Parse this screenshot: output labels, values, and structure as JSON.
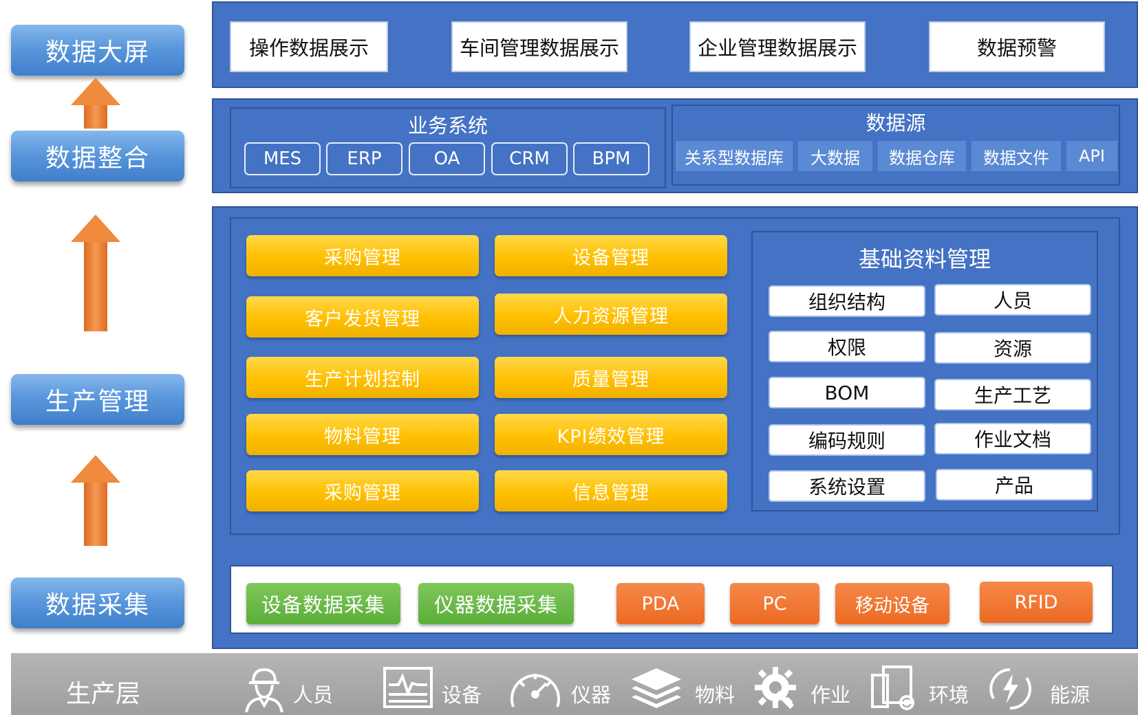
{
  "stages": {
    "display": "数据大屏",
    "integration": "数据整合",
    "production": "生产管理",
    "collection": "数据采集"
  },
  "top_row": [
    "操作数据展示",
    "车间管理数据展示",
    "企业管理数据展示",
    "数据预警"
  ],
  "business_system": {
    "title": "业务系统",
    "items": [
      "MES",
      "ERP",
      "OA",
      "CRM",
      "BPM"
    ]
  },
  "data_source": {
    "title": "数据源",
    "items": [
      "关系型数据库",
      "大数据",
      "数据仓库",
      "数据文件",
      "API"
    ]
  },
  "management_modules": {
    "left": [
      "采购管理",
      "客户发货管理",
      "生产计划控制",
      "物料管理",
      "采购管理"
    ],
    "right": [
      "设备管理",
      "人力资源管理",
      "质量管理",
      "KPI绩效管理",
      "信息管理"
    ]
  },
  "basic_data": {
    "title": "基础资料管理",
    "items": [
      "组织结构",
      "人员",
      "权限",
      "资源",
      "BOM",
      "生产工艺",
      "编码规则",
      "作业文档",
      "系统设置",
      "产品"
    ]
  },
  "collection_row": {
    "green": [
      "设备数据采集",
      "仪器数据采集"
    ],
    "orange": [
      "PDA",
      "PC",
      "移动设备",
      "RFID"
    ]
  },
  "production_layer": {
    "title": "生产层",
    "items": [
      {
        "label": "人员",
        "icon": "worker-icon"
      },
      {
        "label": "设备",
        "icon": "monitor-icon"
      },
      {
        "label": "仪器",
        "icon": "gauge-icon"
      },
      {
        "label": "物料",
        "icon": "layers-icon"
      },
      {
        "label": "作业",
        "icon": "gear-wrench-icon"
      },
      {
        "label": "环境",
        "icon": "devices-icon"
      },
      {
        "label": "能源",
        "icon": "energy-icon"
      }
    ]
  },
  "colors": {
    "panel_blue": "#4472c4",
    "stage_blue": "#5a97dc",
    "arrow_orange": "#f08a3c",
    "module_yellow": "#ffc000",
    "collect_green": "#5cae3a",
    "device_orange": "#ec6a22",
    "layer_gray": "#a6a6a6"
  }
}
